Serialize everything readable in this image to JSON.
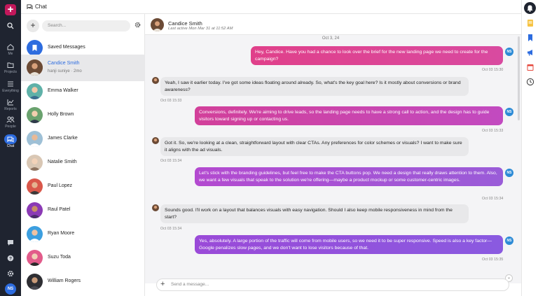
{
  "app": {
    "title": "Chat"
  },
  "nav": {
    "items": [
      {
        "label": "Me"
      },
      {
        "label": "Projects"
      },
      {
        "label": "Everything"
      },
      {
        "label": "Reports"
      },
      {
        "label": "People"
      },
      {
        "label": "Chat"
      }
    ],
    "user_initials": "NS"
  },
  "search": {
    "placeholder": "Search..."
  },
  "chats": [
    {
      "name": "Saved Messages",
      "sub": ""
    },
    {
      "name": "Candice Smith",
      "sub": "hanji suniye · 2mo",
      "active": true
    },
    {
      "name": "Emma Walker",
      "sub": ""
    },
    {
      "name": "Holly Brown",
      "sub": ""
    },
    {
      "name": "James Clarke",
      "sub": ""
    },
    {
      "name": "Natalie Smith",
      "sub": ""
    },
    {
      "name": "Paul Lopez",
      "sub": ""
    },
    {
      "name": "Raul Patel",
      "sub": ""
    },
    {
      "name": "Ryan Moore",
      "sub": ""
    },
    {
      "name": "Suzu Toda",
      "sub": ""
    },
    {
      "name": "William Rogers",
      "sub": ""
    }
  ],
  "conversation": {
    "name": "Candice Smith",
    "last_active": "Last active Mon Mar 31 at 11:52 AM",
    "date_separator": "Oct 3, 24",
    "my_initials": "NS",
    "messages": [
      {
        "dir": "out",
        "text": "Hey, Candice. Have you had a chance to look over the brief for the new landing page we need to create for the campaign?",
        "time": "Oct 03 15:30"
      },
      {
        "dir": "in",
        "text": "Yeah, I saw it earlier today. I've got some ideas floating around already. So, what's the key goal here? Is it mostly about conversions or brand awareness?",
        "time": "Oct 03 15:33"
      },
      {
        "dir": "out",
        "text": "Conversions, definitely. We're aiming to drive leads, so the landing page needs to have a strong call to action, and the design has to guide visitors toward signing up or contacting us.",
        "time": "Oct 03 15:33"
      },
      {
        "dir": "in",
        "text": "Got it. So, we're looking at a clean, straightforward layout with clear CTAs. Any preferences for color schemes or visuals? I want to make sure it aligns with the ad visuals.",
        "time": "Oct 03 15:34"
      },
      {
        "dir": "out",
        "text": "Let's stick with the branding guidelines, but feel free to make the CTA buttons pop. We need a design that really draws attention to them. Also, we want a few visuals that speak to the solution we're offering—maybe a product mockup or some customer-centric images.",
        "time": "Oct 03 15:34"
      },
      {
        "dir": "in",
        "text": "Sounds good. I'll work on a layout that balances visuals with easy navigation. Should I also keep mobile responsiveness in mind from the start?",
        "time": "Oct 03 15:34"
      },
      {
        "dir": "out",
        "text": "Yes, absolutely. A large portion of the traffic will come from mobile users, so we need it to be super responsive. Speed is also a key factor—Google penalizes slow pages, and we don't want to lose visitors because of that.",
        "time": "Oct 03 15:35"
      }
    ]
  },
  "composer": {
    "placeholder": "Send a message..."
  },
  "colors": {
    "accent": "#2d6cdf",
    "bubble_start": "#e0408a",
    "bubble_end": "#9a5cd8"
  }
}
